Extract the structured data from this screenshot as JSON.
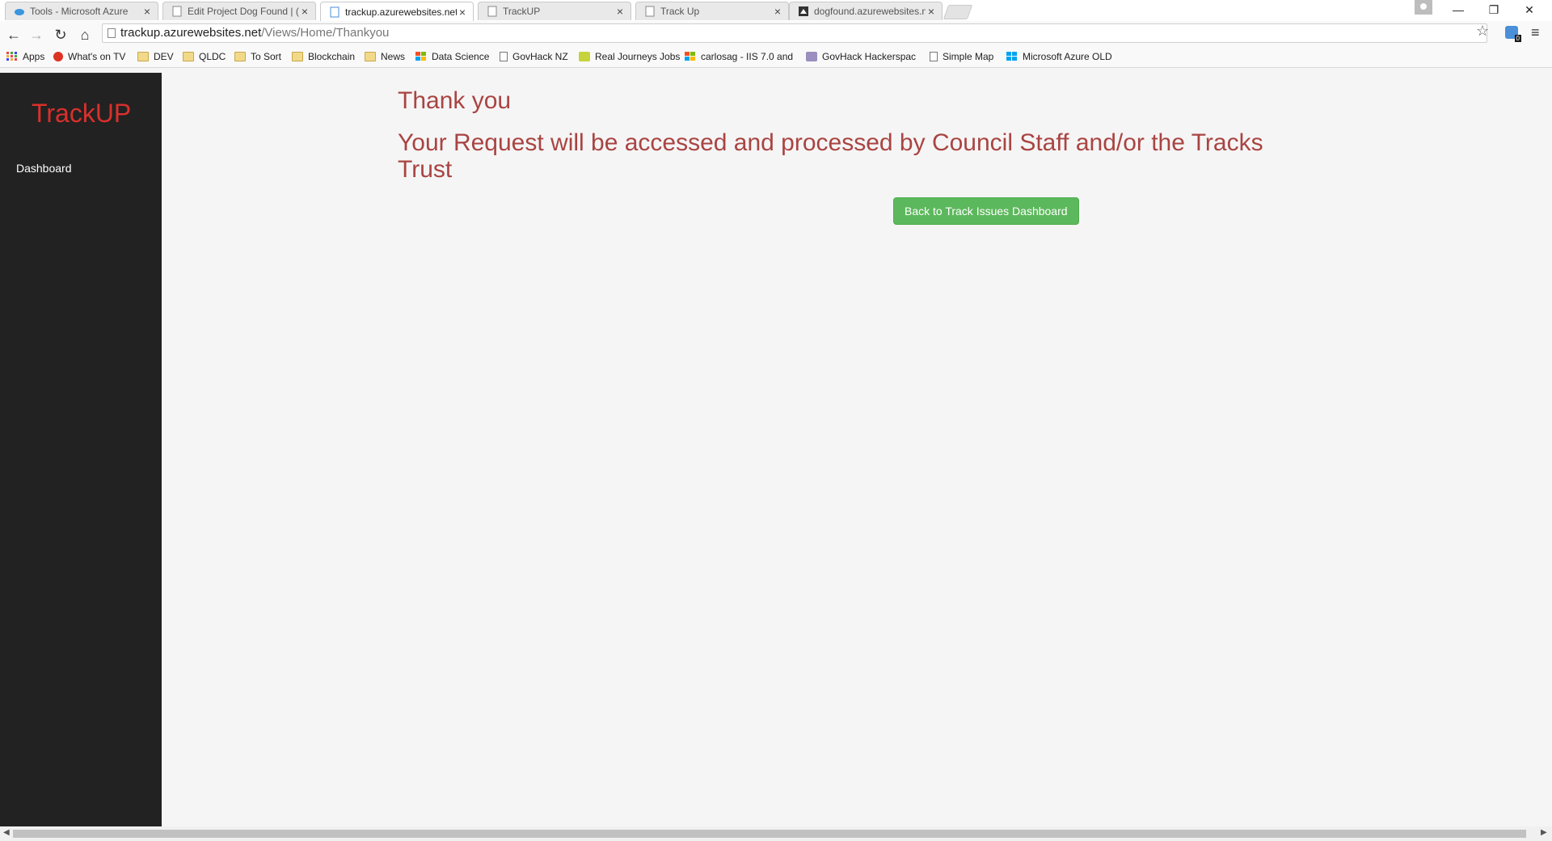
{
  "browser": {
    "tabs": [
      {
        "title": "Tools - Microsoft Azure",
        "active": false,
        "icon": "cloud-icon"
      },
      {
        "title": "Edit Project Dog Found | (",
        "active": false,
        "icon": "page-icon"
      },
      {
        "title": "trackup.azurewebsites.net",
        "active": true,
        "icon": "page-icon"
      },
      {
        "title": "TrackUP",
        "active": false,
        "icon": "page-icon"
      },
      {
        "title": "Track Up",
        "active": false,
        "icon": "page-icon"
      },
      {
        "title": "dogfound.azurewebsites.n",
        "active": false,
        "icon": "dog-icon"
      }
    ],
    "url_host": "trackup.azurewebsites.net",
    "url_path": "/Views/Home/Thankyou",
    "extension_badge": "0",
    "bookmarks": [
      {
        "label": "Apps",
        "icon": "apps-grid-icon"
      },
      {
        "label": "What's on TV",
        "icon": "red-badge-icon"
      },
      {
        "label": "DEV",
        "icon": "folder-icon"
      },
      {
        "label": "QLDC",
        "icon": "folder-icon"
      },
      {
        "label": "To Sort",
        "icon": "folder-icon"
      },
      {
        "label": "Blockchain",
        "icon": "folder-icon"
      },
      {
        "label": "News",
        "icon": "folder-icon"
      },
      {
        "label": "Data Science",
        "icon": "windows-icon"
      },
      {
        "label": "GovHack NZ",
        "icon": "page-icon"
      },
      {
        "label": "Real Journeys Jobs",
        "icon": "leaf-icon"
      },
      {
        "label": "carlosag - IIS 7.0 and",
        "icon": "windows-icon"
      },
      {
        "label": "GovHack Hackerspac",
        "icon": "site-icon"
      },
      {
        "label": "Simple Map",
        "icon": "page-icon"
      },
      {
        "label": "Microsoft Azure OLD",
        "icon": "windows-icon"
      }
    ]
  },
  "sidebar": {
    "brand": "TrackUP",
    "items": [
      {
        "label": "Dashboard"
      }
    ]
  },
  "main": {
    "heading": "Thank you",
    "message": "Your Request will be accessed and processed by Council Staff and/or the Tracks Trust",
    "back_button": "Back to Track Issues Dashboard"
  },
  "colors": {
    "brand": "#d9302c",
    "heading": "#a94442",
    "button": "#5cb85c",
    "sidebar": "#222222"
  }
}
